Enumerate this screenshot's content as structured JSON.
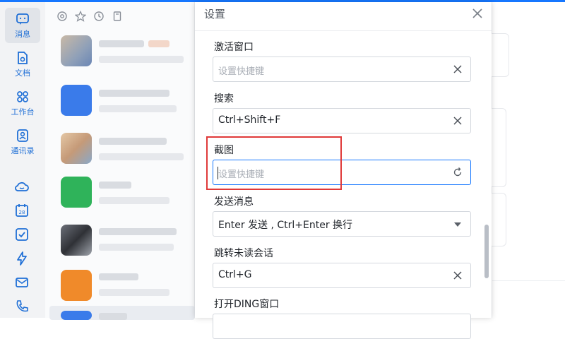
{
  "nav": {
    "items": [
      {
        "label": "消息",
        "icon": "chat-bubble-icon"
      },
      {
        "label": "文档",
        "icon": "document-icon"
      },
      {
        "label": "工作台",
        "icon": "workbench-icon"
      },
      {
        "label": "通讯录",
        "icon": "contacts-icon"
      }
    ],
    "icons": [
      "cloud-icon",
      "calendar-icon",
      "todo-check-icon",
      "ding-bolt-icon",
      "mail-icon",
      "phone-icon"
    ],
    "calendar_day": "28",
    "accent": "#1f6fd6"
  },
  "dialog": {
    "title": "设置",
    "fields": [
      {
        "label": "激活窗口",
        "value": "",
        "placeholder": "设置快捷键",
        "action": "clear-icon"
      },
      {
        "label": "搜索",
        "value": "Ctrl+Shift+F",
        "placeholder": "",
        "action": "clear-icon"
      },
      {
        "label": "截图",
        "value": "",
        "placeholder": "设置快捷键",
        "action": "reset-icon",
        "focused": true
      },
      {
        "label": "发送消息",
        "value": "Enter 发送 , Ctrl+Enter 换行",
        "placeholder": "",
        "action": "dropdown-arrow-icon"
      },
      {
        "label": "跳转未读会话",
        "value": "Ctrl+G",
        "placeholder": "",
        "action": "clear-icon"
      },
      {
        "label": "打开DING窗口",
        "value": "",
        "placeholder": "",
        "action": ""
      }
    ]
  },
  "colors": {
    "highlight": "#e03a3a",
    "focus": "#1677ff"
  }
}
